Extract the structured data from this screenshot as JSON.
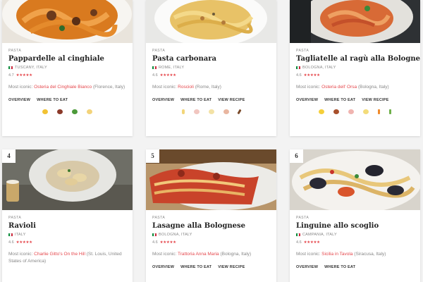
{
  "colors": {
    "accent": "#e5484d",
    "star": "#e5484d",
    "flag_green": "#0a8c3a",
    "flag_red": "#cd2a3e"
  },
  "cards": [
    {
      "rank": "",
      "category": "PASTA",
      "name": "Pappardelle al cinghiale",
      "origin": "TUSCANY, ITALY",
      "rating": "4.7",
      "stars": "★★★★★",
      "iconic_label": "Most iconic:",
      "iconic_place": "Osteria del Cinghiale Bianco",
      "iconic_location": "(Florence, Italy)",
      "actions": [
        "OVERVIEW",
        "WHERE TO EAT"
      ],
      "ingredients": [
        "pasta-icon",
        "meat-icon",
        "herb-icon",
        "cheese-icon"
      ]
    },
    {
      "rank": "",
      "category": "PASTA",
      "name": "Pasta carbonara",
      "origin": "ROME, ITALY",
      "rating": "4.6",
      "stars": "★★★★★",
      "iconic_label": "Most iconic:",
      "iconic_place": "Roscioli",
      "iconic_location": "(Rome, Italy)",
      "actions": [
        "OVERVIEW",
        "WHERE TO EAT",
        "VIEW RECIPE"
      ],
      "ingredients": [
        "pasta-icon",
        "guanciale-icon",
        "cheese-icon",
        "egg-icon",
        "pepper-icon"
      ]
    },
    {
      "rank": "",
      "category": "PASTA",
      "name": "Tagliatelle al ragù alla Bolognese",
      "origin": "BOLOGNA, ITALY",
      "rating": "4.6",
      "stars": "★★★★★",
      "iconic_label": "Most iconic:",
      "iconic_place": "Osteria dell' Orsa",
      "iconic_location": "(Bologna, Italy)",
      "actions": [
        "OVERVIEW",
        "WHERE TO EAT",
        "VIEW RECIPE"
      ],
      "ingredients": [
        "pasta-icon",
        "beef-icon",
        "pork-icon",
        "cheese-icon",
        "carrot-icon",
        "celery-icon"
      ]
    },
    {
      "rank": "4",
      "category": "PASTA",
      "name": "Ravioli",
      "origin": "ITALY",
      "rating": "4.6",
      "stars": "★★★★★",
      "iconic_label": "Most iconic:",
      "iconic_place": "Charlie Gitto's On the Hill",
      "iconic_location": "(St. Louis, United States of America)",
      "actions": [],
      "ingredients": []
    },
    {
      "rank": "5",
      "category": "PASTA",
      "name": "Lasagne alla Bolognese",
      "origin": "BOLOGNA, ITALY",
      "rating": "4.6",
      "stars": "★★★★★",
      "iconic_label": "Most iconic:",
      "iconic_place": "Trattoria Anna Maria",
      "iconic_location": "(Bologna, Italy)",
      "actions": [
        "OVERVIEW",
        "WHERE TO EAT",
        "VIEW RECIPE"
      ],
      "ingredients": []
    },
    {
      "rank": "6",
      "category": "PASTA",
      "name": "Linguine allo scoglio",
      "origin": "CAMPANIA, ITALY",
      "rating": "4.6",
      "stars": "★★★★★",
      "iconic_label": "Most iconic:",
      "iconic_place": "Sicilia in Tavola",
      "iconic_location": "(Siracusa, Italy)",
      "actions": [
        "OVERVIEW",
        "WHERE TO EAT"
      ],
      "ingredients": []
    }
  ]
}
